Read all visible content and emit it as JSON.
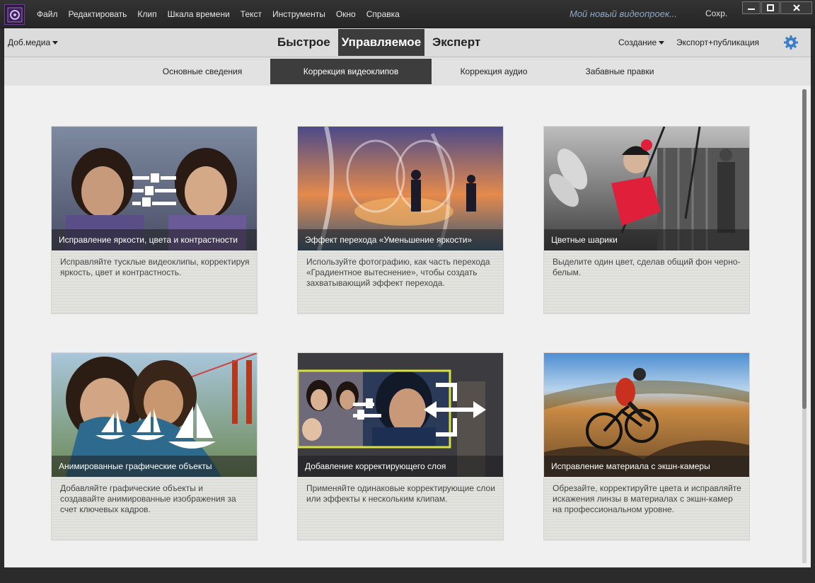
{
  "app": {
    "menu": [
      "Файл",
      "Редактировать",
      "Клип",
      "Шкала времени",
      "Текст",
      "Инструменты",
      "Окно",
      "Справка"
    ],
    "project_name": "Мой новый видеопроек...",
    "save_label": "Сохр."
  },
  "modebar": {
    "add_media": "Доб.медиа",
    "tabs": [
      "Быстрое",
      "Управляемое",
      "Эксперт"
    ],
    "active_tab": "Управляемое",
    "create": "Создание",
    "export": "Экспорт+публикация"
  },
  "subtabs": {
    "items": [
      "Основные сведения",
      "Коррекция видеоклипов",
      "Коррекция аудио",
      "Забавные правки"
    ],
    "active": "Коррекция видеоклипов"
  },
  "cards": [
    {
      "title": "Исправление яркости, цвета и контрастности",
      "description": "Исправляйте тусклые видеоклипы, корректируя яркость, цвет и контрастность."
    },
    {
      "title": "Эффект перехода «Уменьшение яркости»",
      "description": "Используйте фотографию, как часть перехода «Градиентное вытеснение», чтобы создать захватывающий эффект перехода."
    },
    {
      "title": "Цветные шарики",
      "description": "Выделите один цвет, сделав общий фон черно-белым."
    },
    {
      "title": "Анимированные графические объекты",
      "description": "Добавляйте графические объекты и создавайте анимированные изображения за счет ключевых кадров."
    },
    {
      "title": "Добавление корректирующего слоя",
      "description": "Применяйте одинаковые корректирующие слои или эффекты к нескольким клипам."
    },
    {
      "title": "Исправление материала с экшн-камеры",
      "description": "Обрезайте, корректируйте цвета и исправляйте искажения линзы в материалах с экшн-камер на профессиональном уровне."
    }
  ],
  "icons": {
    "app_logo": "premiere-elements-logo-icon",
    "settings": "gear-icon",
    "window": [
      "minimize-icon",
      "maximize-icon",
      "close-icon"
    ]
  },
  "colors": {
    "accent_active_tab": "#3c3c3c",
    "project_name": "#8fa8c8"
  }
}
